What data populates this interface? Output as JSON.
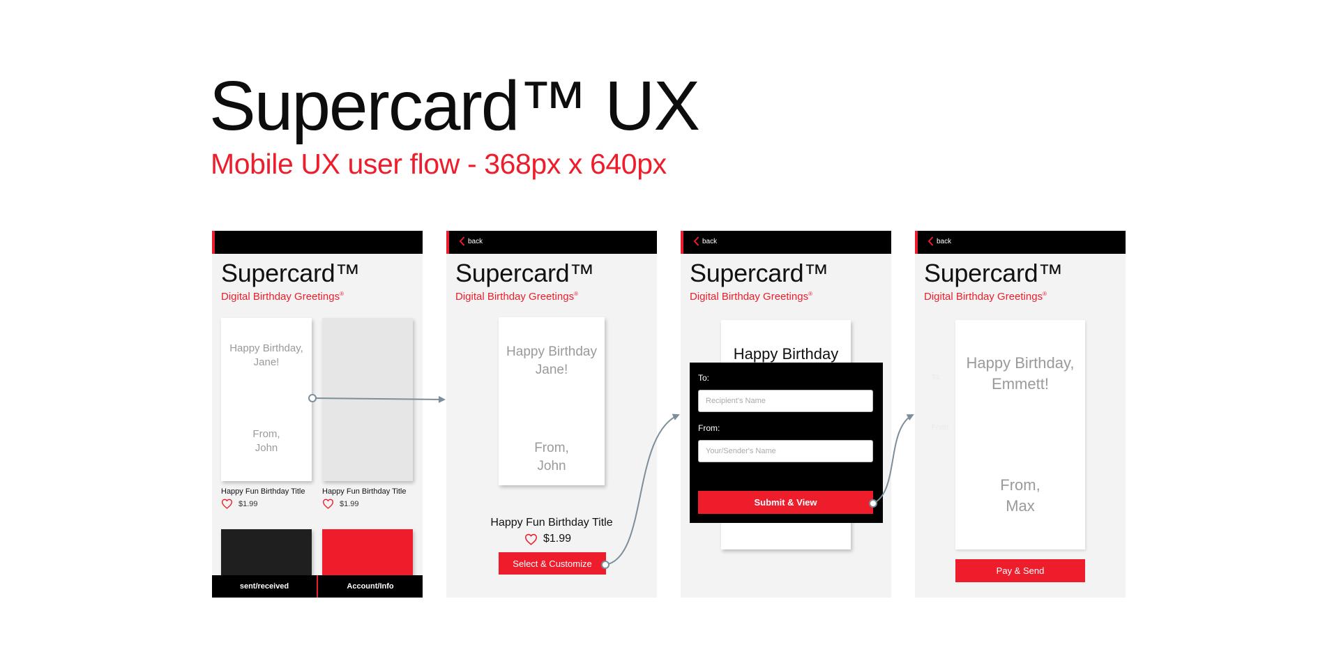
{
  "page": {
    "title": "Supercard™ UX",
    "subtitle": "Mobile UX user flow - 368px x 640px"
  },
  "app": {
    "title": "Supercard™",
    "subtitle": "Digital Birthday Greetings",
    "subtitle_mark": "®",
    "back_label": "back"
  },
  "screen1": {
    "card1": {
      "greeting": "Happy Birthday,\nJane!",
      "signoff": "From,\nJohn"
    },
    "item1": {
      "title": "Happy Fun Birthday Title",
      "price": "$1.99"
    },
    "item2": {
      "title": "Happy Fun Birthday Title",
      "price": "$1.99"
    },
    "bottom_nav": {
      "left": "sent/received",
      "right": "Account/Info"
    }
  },
  "screen2": {
    "card": {
      "greeting": "Happy Birthday\nJane!",
      "signoff": "From,\nJohn"
    },
    "item": {
      "title": "Happy Fun Birthday Title",
      "price": "$1.99"
    },
    "cta": "Select & Customize"
  },
  "screen3": {
    "card_greeting": "Happy Birthday",
    "form": {
      "to_label": "To:",
      "to_placeholder": "Recipient's Name",
      "from_label": "From:",
      "from_placeholder": "Your/Sender's Name",
      "submit": "Submit & View"
    }
  },
  "screen4": {
    "ghost_to": "To:",
    "ghost_from": "From:",
    "card": {
      "greeting": "Happy Birthday,\nEmmett!",
      "signoff": "From,\nMax"
    },
    "cta": "Pay & Send"
  },
  "colors": {
    "accent": "#ee1d2b",
    "black": "#000000",
    "screen_bg": "#f3f3f3",
    "connector": "#7b8e9a"
  },
  "icons": {
    "back": "chevron-left-icon",
    "like": "heart-icon"
  }
}
